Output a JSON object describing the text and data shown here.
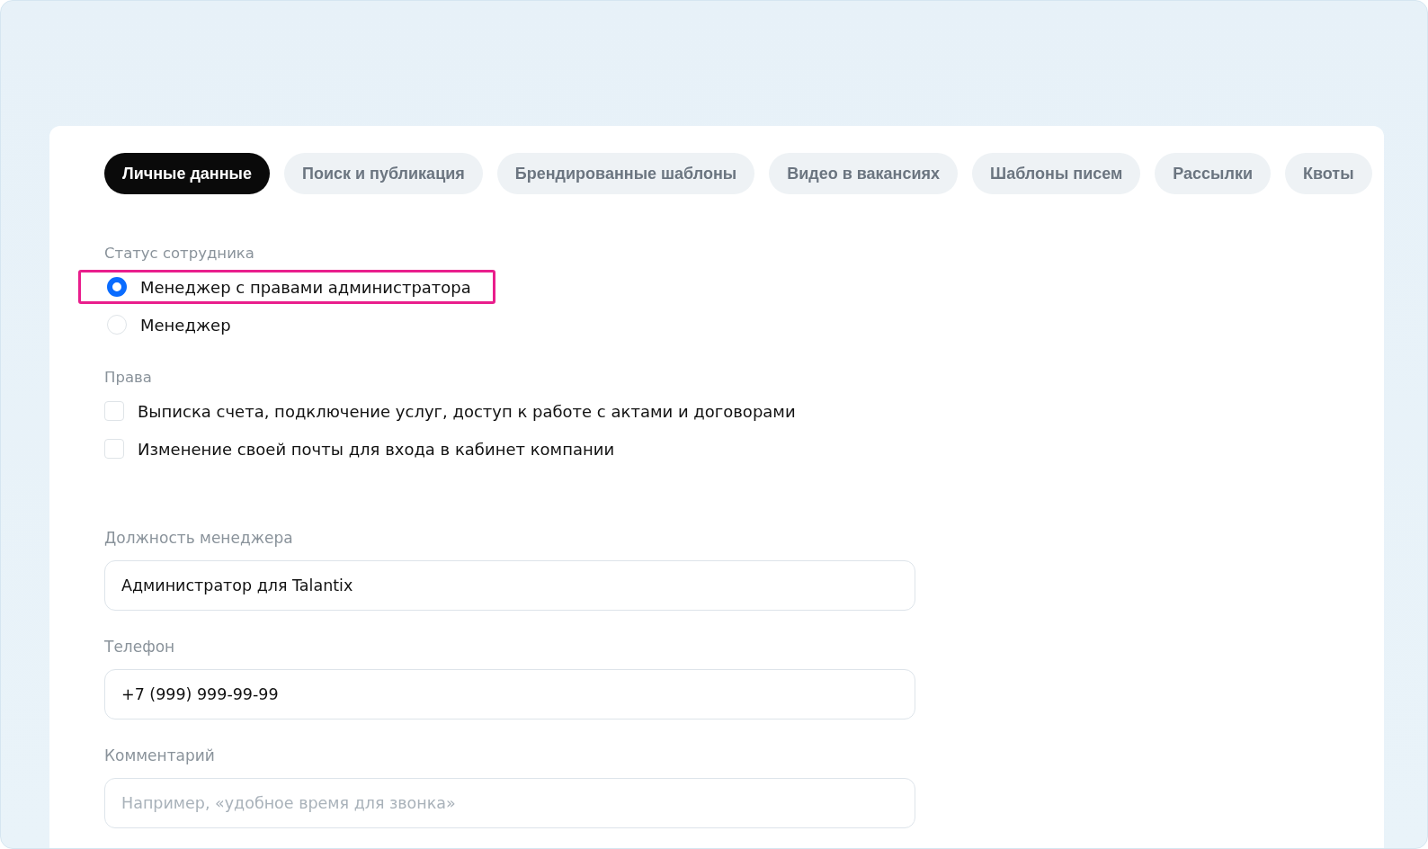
{
  "tabs": [
    {
      "label": "Личные данные",
      "selected": true
    },
    {
      "label": "Поиск и публикация",
      "selected": false
    },
    {
      "label": "Брендированные шаблоны",
      "selected": false
    },
    {
      "label": "Видео в вакансиях",
      "selected": false
    },
    {
      "label": "Шаблоны писем",
      "selected": false
    },
    {
      "label": "Рассылки",
      "selected": false
    },
    {
      "label": "Квоты",
      "selected": false
    }
  ],
  "status": {
    "label": "Статус сотрудника",
    "options": [
      {
        "label": "Менеджер с правами администратора",
        "selected": true,
        "highlighted": true
      },
      {
        "label": "Менеджер",
        "selected": false,
        "highlighted": false
      }
    ]
  },
  "rights": {
    "label": "Права",
    "items": [
      {
        "label": "Выписка счета, подключение услуг, доступ к работе с актами и договорами",
        "checked": false
      },
      {
        "label": "Изменение своей почты для входа в кабинет компании",
        "checked": false
      }
    ]
  },
  "fields": [
    {
      "label": "Должность менеджера",
      "value": "Администратор для Talantix"
    },
    {
      "label": "Телефон",
      "value": "+7 (999) 999-99-99"
    },
    {
      "label": "Комментарий",
      "placeholder": "Например, «удобное время для звонка»"
    }
  ]
}
